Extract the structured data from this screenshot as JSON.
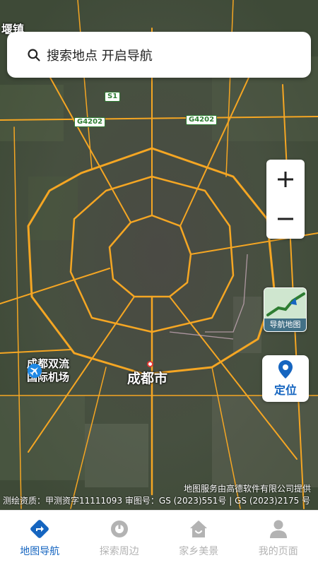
{
  "map": {
    "town_label": "堰镇",
    "city_label": "成都市",
    "airport_label_line1": "成都双流",
    "airport_label_line2": "国际机场",
    "shields": [
      "S1",
      "G4202",
      "G4202"
    ],
    "attribution": "地图服务由高德软件有限公司提供",
    "approvals": "测绘资质：甲测资字11111093  审图号：GS (2023)551号 | GS (2023)2175 号"
  },
  "search": {
    "placeholder": "搜索地点 开启导航",
    "icon": "search-icon"
  },
  "controls": {
    "zoom_in_icon": "plus-icon",
    "zoom_out_icon": "minus-icon",
    "nav_map_label": "导航地图",
    "locate_label": "定位",
    "locate_icon": "map-pin-icon"
  },
  "tabs": [
    {
      "label": "地图导航",
      "icon": "navigation-diamond-icon",
      "active": true
    },
    {
      "label": "探索周边",
      "icon": "explore-icon",
      "active": false
    },
    {
      "label": "家乡美景",
      "icon": "house-icon",
      "active": false
    },
    {
      "label": "我的页面",
      "icon": "person-icon",
      "active": false
    }
  ],
  "colors": {
    "accent": "#1565c0",
    "road": "#f5a623",
    "inactive_tab": "#b3b3b3"
  }
}
